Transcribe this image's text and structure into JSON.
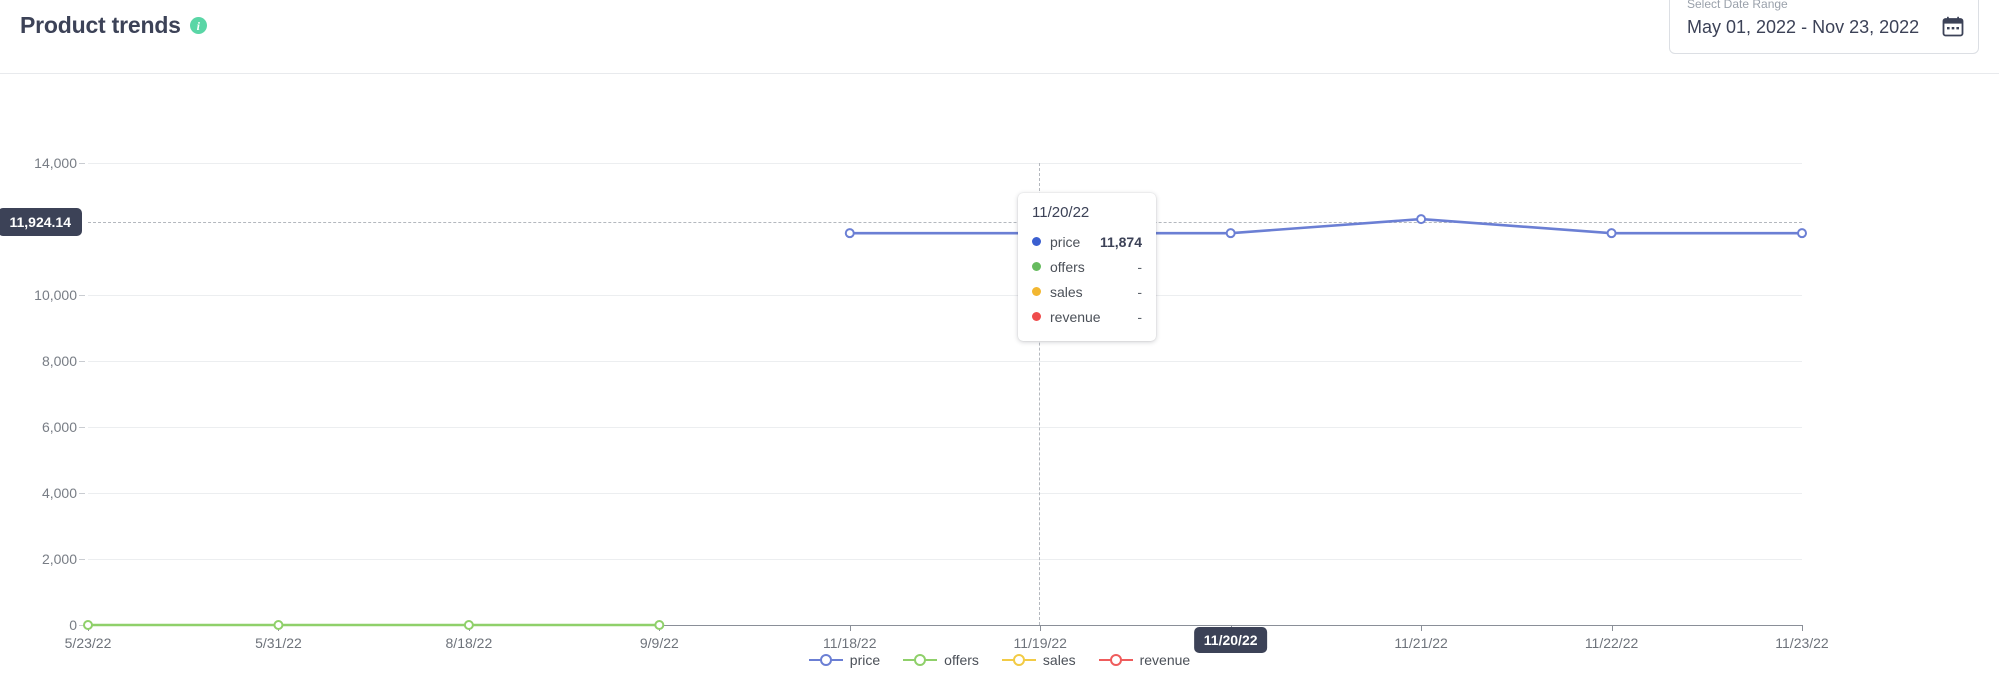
{
  "header": {
    "title": "Product trends",
    "info_icon": "info-icon",
    "date_range": {
      "legend": "Select Date Range",
      "value": "May 01, 2022 - Nov 23, 2022",
      "icon": "calendar-icon"
    }
  },
  "tooltip": {
    "date": "11/20/22",
    "rows": [
      {
        "name": "price",
        "value": "11,874",
        "color": "#3b5fd0"
      },
      {
        "name": "offers",
        "value": "-",
        "color": "#66bb5e"
      },
      {
        "name": "sales",
        "value": "-",
        "color": "#f2b731"
      },
      {
        "name": "revenue",
        "value": "-",
        "color": "#ef4c4c"
      }
    ]
  },
  "reference": {
    "label": "11,924.14",
    "value": 11924.14
  },
  "active_x_label": "11/20/22",
  "chart_data": {
    "type": "line",
    "title": "Product trends",
    "xlabel": "",
    "ylabel": "",
    "grid": true,
    "legend_position": "bottom",
    "ylim": [
      0,
      14000
    ],
    "yticks": [
      0,
      2000,
      4000,
      6000,
      8000,
      10000,
      14000
    ],
    "ytick_labels": [
      "0",
      "2,000",
      "4,000",
      "6,000",
      "8,000",
      "10,000",
      "14,000"
    ],
    "categories": [
      "5/23/22",
      "5/31/22",
      "8/18/22",
      "9/9/22",
      "11/18/22",
      "11/19/22",
      "11/20/22",
      "11/21/22",
      "11/22/22",
      "11/23/22"
    ],
    "series": [
      {
        "name": "price",
        "color": "#6b7fd4",
        "values": [
          null,
          null,
          null,
          null,
          11874,
          11874,
          11874,
          12300,
          11874,
          11874
        ]
      },
      {
        "name": "offers",
        "color": "#8fd06a",
        "values": [
          0,
          0,
          0,
          0,
          null,
          null,
          null,
          null,
          null,
          null
        ]
      },
      {
        "name": "sales",
        "color": "#f2cb45",
        "values": [
          null,
          null,
          null,
          null,
          null,
          null,
          null,
          null,
          null,
          null
        ]
      },
      {
        "name": "revenue",
        "color": "#ef5c5c",
        "values": [
          null,
          null,
          null,
          null,
          null,
          null,
          null,
          null,
          null,
          null
        ]
      }
    ]
  }
}
